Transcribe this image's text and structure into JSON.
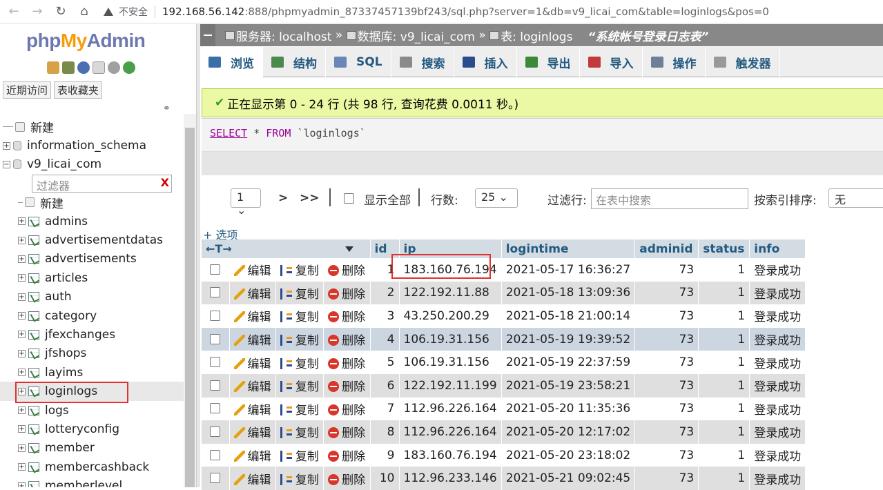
{
  "browser": {
    "back": "←",
    "forward": "→",
    "reload": "↻",
    "home": "⌂",
    "security": "不安全",
    "url_host": "192.168.56.142",
    "url_rest": ":888/phpmyadmin_87337457139bf243/sql.php?server=1&db=v9_licai_com&table=loginlogs&pos=0"
  },
  "sidebar": {
    "logo_php": "php",
    "logo_my": "My",
    "logo_admin": "Admin",
    "recent": "近期访问",
    "favorites": "表收藏夹",
    "filter_placeholder": "过滤器",
    "filter_clear": "X",
    "tree": [
      {
        "type": "new",
        "label": "新建",
        "level": 0
      },
      {
        "type": "db",
        "label": "information_schema",
        "level": 0,
        "exp": "+"
      },
      {
        "type": "db",
        "label": "v9_licai_com",
        "level": 0,
        "exp": "−"
      },
      {
        "type": "new",
        "label": "新建",
        "level": 1
      },
      {
        "type": "table",
        "label": "admins",
        "level": 1
      },
      {
        "type": "table",
        "label": "advertisementdatas",
        "level": 1
      },
      {
        "type": "table",
        "label": "advertisements",
        "level": 1
      },
      {
        "type": "table",
        "label": "articles",
        "level": 1
      },
      {
        "type": "table",
        "label": "auth",
        "level": 1
      },
      {
        "type": "table",
        "label": "category",
        "level": 1
      },
      {
        "type": "table",
        "label": "jfexchanges",
        "level": 1
      },
      {
        "type": "table",
        "label": "jfshops",
        "level": 1
      },
      {
        "type": "table",
        "label": "layims",
        "level": 1
      },
      {
        "type": "table",
        "label": "loginlogs",
        "level": 1,
        "selected": true
      },
      {
        "type": "table",
        "label": "logs",
        "level": 1
      },
      {
        "type": "table",
        "label": "lotteryconfig",
        "level": 1
      },
      {
        "type": "table",
        "label": "member",
        "level": 1
      },
      {
        "type": "table",
        "label": "membercashback",
        "level": 1
      },
      {
        "type": "table",
        "label": "memberlevel",
        "level": 1
      }
    ]
  },
  "breadcrumb": {
    "server": "服务器: localhost",
    "sep1": "»",
    "database": "数据库: v9_licai_com",
    "sep2": "»",
    "table": "表: loginlogs",
    "comment": "“系统帐号登录日志表”"
  },
  "tabs": [
    {
      "label": "浏览",
      "icon": "browse-icon",
      "color": "#3b6fa8"
    },
    {
      "label": "结构",
      "icon": "structure-icon",
      "color": "#4a8a4a"
    },
    {
      "label": "SQL",
      "icon": "sql-icon",
      "color": "#6a86b6"
    },
    {
      "label": "搜索",
      "icon": "search-icon",
      "color": "#8a8a8a"
    },
    {
      "label": "插入",
      "icon": "insert-icon",
      "color": "#2b4c8c"
    },
    {
      "label": "导出",
      "icon": "export-icon",
      "color": "#3a8a3a"
    },
    {
      "label": "导入",
      "icon": "import-icon",
      "color": "#c23a3a"
    },
    {
      "label": "操作",
      "icon": "wrench-icon",
      "color": "#6f7f95"
    },
    {
      "label": "触发器",
      "icon": "trigger-icon",
      "color": "#999999"
    }
  ],
  "message": {
    "check": "✔",
    "text": "正在显示第 0 - 24 行 (共 98 行, 查询花费 0.0011 秒。)"
  },
  "sql": {
    "select": "SELECT",
    "star": "*",
    "from": "FROM",
    "table": "`loginlogs`"
  },
  "nav": {
    "page": "1",
    "next": ">",
    "last": ">>",
    "show_all": "显示全部",
    "rows_label": "行数:",
    "rows_value": "25",
    "filter_label": "过滤行:",
    "filter_placeholder": "在表中搜索",
    "sort_label": "按索引排序:",
    "sort_value": "无"
  },
  "options_link": "+ 选项",
  "table": {
    "nav_arrows": "←T→",
    "columns": [
      "id",
      "ip",
      "logintime",
      "adminid",
      "status",
      "info"
    ],
    "actions": {
      "edit": "编辑",
      "copy": "复制",
      "delete": "删除"
    },
    "rows": [
      {
        "id": "1",
        "ip": "183.160.76.194",
        "logintime": "2021-05-17 16:36:27",
        "adminid": "73",
        "status": "1",
        "info": "登录成功"
      },
      {
        "id": "2",
        "ip": "122.192.11.88",
        "logintime": "2021-05-18 13:09:36",
        "adminid": "73",
        "status": "1",
        "info": "登录成功"
      },
      {
        "id": "3",
        "ip": "43.250.200.29",
        "logintime": "2021-05-18 21:00:14",
        "adminid": "73",
        "status": "1",
        "info": "登录成功"
      },
      {
        "id": "4",
        "ip": "106.19.31.156",
        "logintime": "2021-05-19 19:39:52",
        "adminid": "73",
        "status": "1",
        "info": "登录成功"
      },
      {
        "id": "5",
        "ip": "106.19.31.156",
        "logintime": "2021-05-19 22:37:59",
        "adminid": "73",
        "status": "1",
        "info": "登录成功"
      },
      {
        "id": "6",
        "ip": "122.192.11.199",
        "logintime": "2021-05-19 23:58:21",
        "adminid": "73",
        "status": "1",
        "info": "登录成功"
      },
      {
        "id": "7",
        "ip": "112.96.226.164",
        "logintime": "2021-05-20 11:35:36",
        "adminid": "73",
        "status": "1",
        "info": "登录成功"
      },
      {
        "id": "8",
        "ip": "112.96.226.164",
        "logintime": "2021-05-20 12:17:02",
        "adminid": "73",
        "status": "1",
        "info": "登录成功"
      },
      {
        "id": "9",
        "ip": "183.160.76.194",
        "logintime": "2021-05-20 23:18:02",
        "adminid": "73",
        "status": "1",
        "info": "登录成功"
      },
      {
        "id": "10",
        "ip": "112.96.233.146",
        "logintime": "2021-05-21 09:02:45",
        "adminid": "73",
        "status": "1",
        "info": "登录成功"
      }
    ]
  }
}
